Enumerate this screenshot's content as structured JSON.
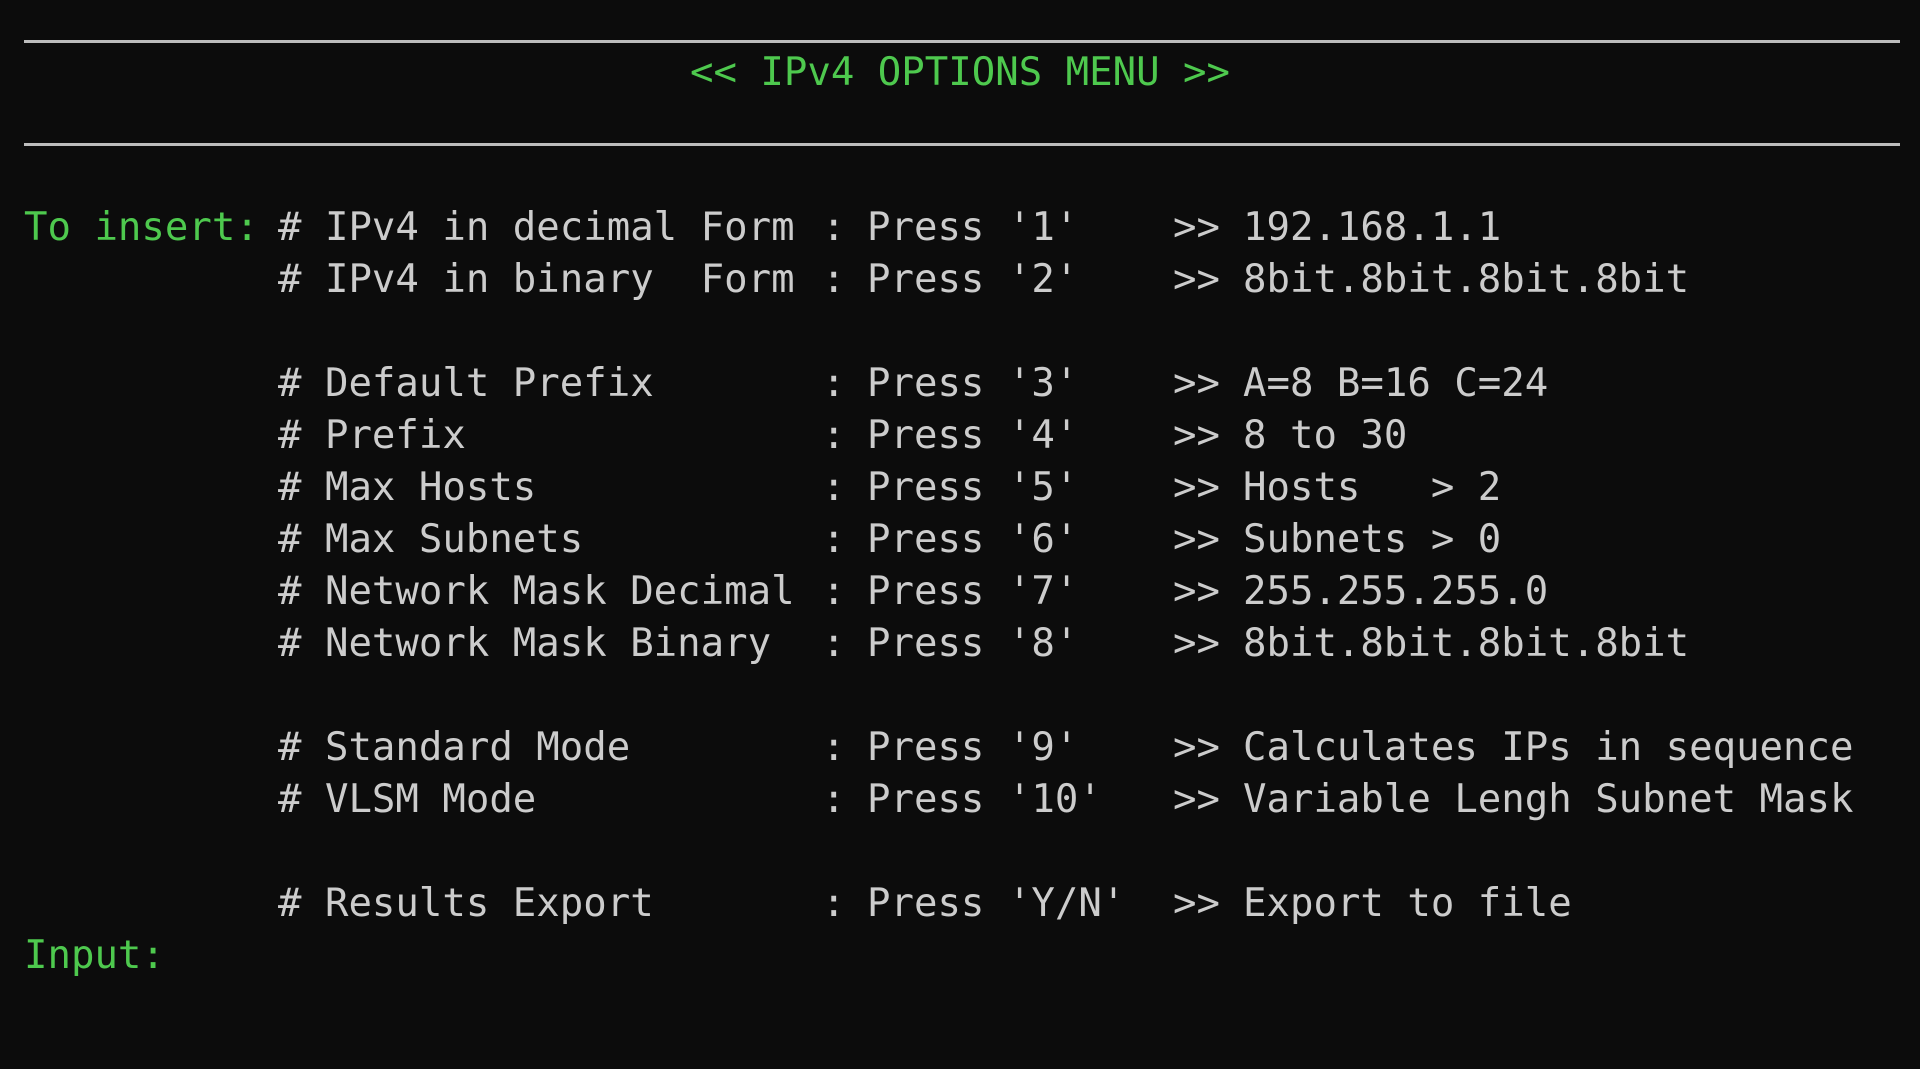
{
  "header": {
    "title": "<< IPv4 OPTIONS MENU >>"
  },
  "intro_label": "To insert:",
  "options": [
    {
      "label": "# IPv4 in decimal Form",
      "sep": ":",
      "press": "Press '1'",
      "arrow": ">>",
      "desc": "192.168.1.1"
    },
    {
      "label": "# IPv4 in binary  Form",
      "sep": ":",
      "press": "Press '2'",
      "arrow": ">>",
      "desc": "8bit.8bit.8bit.8bit"
    },
    {
      "label": "# Default Prefix",
      "sep": ":",
      "press": "Press '3'",
      "arrow": ">>",
      "desc": "A=8 B=16 C=24"
    },
    {
      "label": "# Prefix",
      "sep": ":",
      "press": "Press '4'",
      "arrow": ">>",
      "desc": "8 to 30"
    },
    {
      "label": "# Max Hosts",
      "sep": ":",
      "press": "Press '5'",
      "arrow": ">>",
      "desc": "Hosts   > 2"
    },
    {
      "label": "# Max Subnets",
      "sep": ":",
      "press": "Press '6'",
      "arrow": ">>",
      "desc": "Subnets > 0"
    },
    {
      "label": "# Network Mask Decimal",
      "sep": ":",
      "press": "Press '7'",
      "arrow": ">>",
      "desc": "255.255.255.0"
    },
    {
      "label": "# Network Mask Binary",
      "sep": ":",
      "press": "Press '8'",
      "arrow": ">>",
      "desc": "8bit.8bit.8bit.8bit"
    },
    {
      "label": "# Standard Mode",
      "sep": ":",
      "press": "Press '9'",
      "arrow": ">>",
      "desc": "Calculates IPs in sequence"
    },
    {
      "label": "# VLSM Mode",
      "sep": ":",
      "press": "Press '10'",
      "arrow": ">>",
      "desc": "Variable Lengh Subnet Mask"
    },
    {
      "label": "# Results Export",
      "sep": ":",
      "press": "Press 'Y/N'",
      "arrow": ">>",
      "desc": "Export to file"
    }
  ],
  "input": {
    "label": "Input:",
    "value": ""
  },
  "colors": {
    "background": "#0c0c0c",
    "text": "#cccccc",
    "accent_green": "#4ec94e",
    "rule": "#bdbdbd"
  }
}
